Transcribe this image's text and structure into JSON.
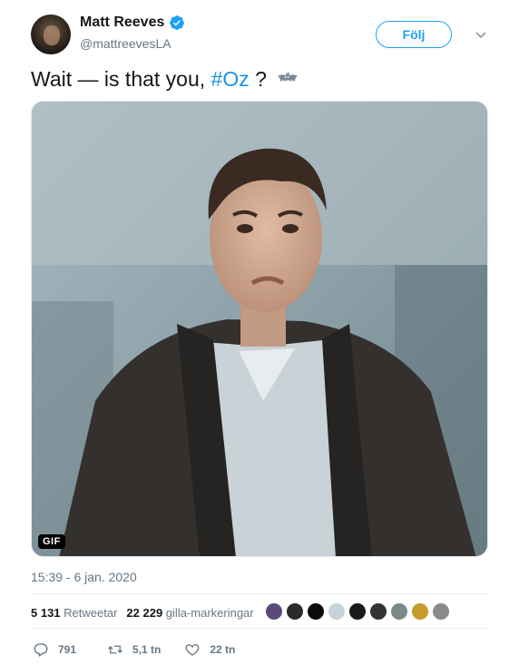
{
  "header": {
    "name": "Matt Reeves",
    "handle": "@mattreevesLA",
    "follow_label": "Följ",
    "verified_icon": "verified-badge-icon",
    "accent": "#1da1f2"
  },
  "tweet": {
    "text_before": "Wait — is that you, ",
    "hashtag": "#Oz",
    "text_after": " ?",
    "emoji": "bat-emoji"
  },
  "media": {
    "badge": "GIF"
  },
  "meta": {
    "timestamp": "15:39 - 6 jan. 2020"
  },
  "stats": {
    "retweets_count": "5 131",
    "retweets_label": "Retweetar",
    "likes_count": "22 229",
    "likes_label": "gilla-markeringar"
  },
  "actions": {
    "reply_count": "791",
    "retweet_count": "5,1 tn",
    "like_count": "22 tn"
  }
}
